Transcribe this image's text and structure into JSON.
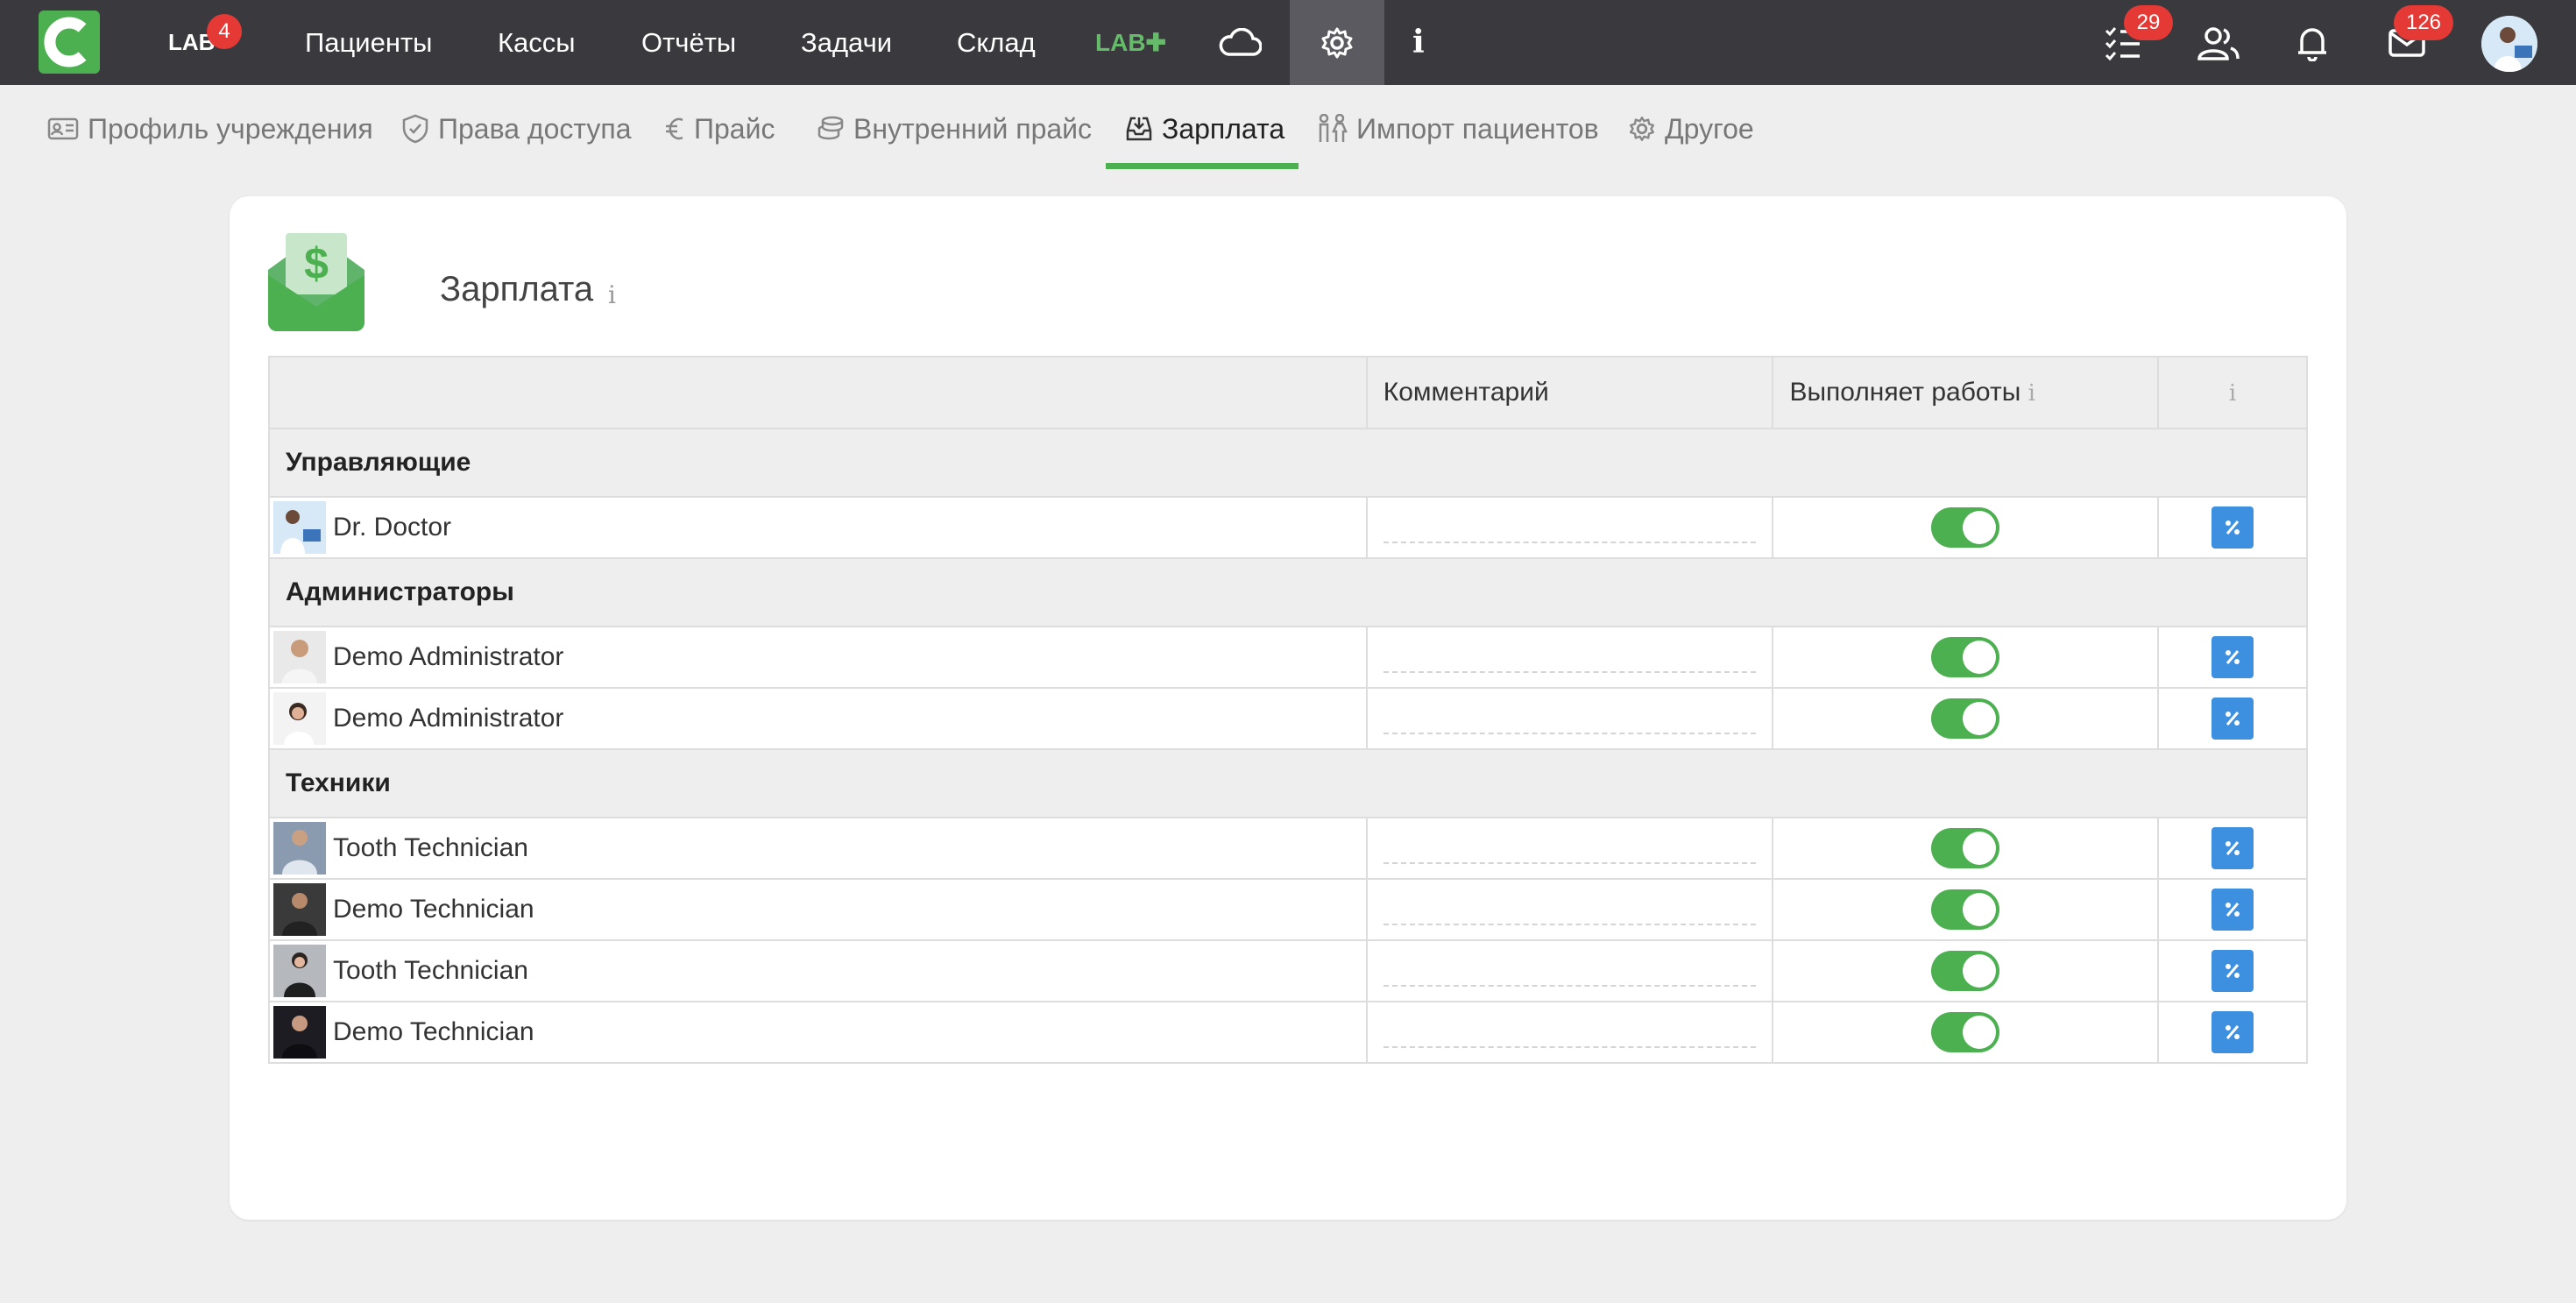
{
  "topbar": {
    "lab_label": "LAB",
    "lab_badge": "4",
    "nav": [
      "Пациенты",
      "Кассы",
      "Отчёты",
      "Задачи",
      "Склад"
    ],
    "labplus_label": "LAB✚",
    "info_label": "i",
    "tasks_badge": "29",
    "mail_badge": "126"
  },
  "subnav": {
    "items": [
      "Профиль учреждения",
      "Права доступа",
      "Прайс",
      "Внутренний прайс",
      "Зарплата",
      "Импорт пациентов",
      "Другое"
    ],
    "active_index": 4
  },
  "card": {
    "title": "Зарплата",
    "info": "i"
  },
  "table": {
    "headers": [
      "",
      "Комментарий",
      "Выполняет работы",
      ""
    ],
    "header_info": "i",
    "groups": [
      {
        "name": "Управляющие",
        "people": [
          {
            "name": "Dr. Doctor",
            "comment": "",
            "works": true
          }
        ]
      },
      {
        "name": "Администраторы",
        "people": [
          {
            "name": "Demo Administrator",
            "comment": "",
            "works": true
          },
          {
            "name": "Demo Administrator",
            "comment": "",
            "works": true
          }
        ]
      },
      {
        "name": "Техники",
        "people": [
          {
            "name": "Tooth Technician",
            "comment": "",
            "works": true
          },
          {
            "name": "Demo Technician",
            "comment": "",
            "works": true
          },
          {
            "name": "Tooth Technician",
            "comment": "",
            "works": true
          },
          {
            "name": "Demo Technician",
            "comment": "",
            "works": true
          }
        ]
      }
    ]
  },
  "colors": {
    "topbar": "#3a3a3e",
    "accent": "#4caf50",
    "button": "#3d8fe0",
    "badge": "#e53935"
  }
}
